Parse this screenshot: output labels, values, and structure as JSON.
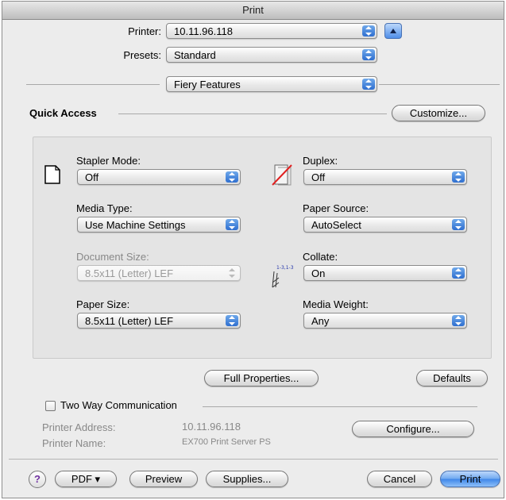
{
  "window": {
    "title": "Print"
  },
  "printer": {
    "label": "Printer:",
    "value": "10.11.96.118"
  },
  "presets": {
    "label": "Presets:",
    "value": "Standard"
  },
  "section_popup": {
    "value": "Fiery Features"
  },
  "quick_access": {
    "title": "Quick Access",
    "customize_label": "Customize..."
  },
  "fields": {
    "stapler_mode": {
      "label": "Stapler Mode:",
      "value": "Off"
    },
    "duplex": {
      "label": "Duplex:",
      "value": "Off"
    },
    "media_type": {
      "label": "Media Type:",
      "value": "Use Machine Settings"
    },
    "paper_source": {
      "label": "Paper Source:",
      "value": "AutoSelect"
    },
    "document_size": {
      "label": "Document Size:",
      "value": "8.5x11 (Letter) LEF"
    },
    "collate": {
      "label": "Collate:",
      "value": "On",
      "icon_text": "1-3,1-3"
    },
    "paper_size": {
      "label": "Paper Size:",
      "value": "8.5x11 (Letter) LEF"
    },
    "media_weight": {
      "label": "Media Weight:",
      "value": "Any"
    }
  },
  "buttons": {
    "full_properties": "Full Properties...",
    "defaults": "Defaults",
    "configure": "Configure...",
    "pdf": "PDF ▾",
    "preview": "Preview",
    "supplies": "Supplies...",
    "cancel": "Cancel",
    "print": "Print",
    "help": "?"
  },
  "two_way": {
    "checkbox_label": "Two Way Communication",
    "checked": false,
    "printer_address_label": "Printer Address:",
    "printer_address_value": "10.11.96.118",
    "printer_name_label": "Printer Name:",
    "printer_name_value": "EX700 Print Server PS"
  },
  "colors": {
    "accent": "#3f86e8",
    "window_bg": "#ececec"
  }
}
